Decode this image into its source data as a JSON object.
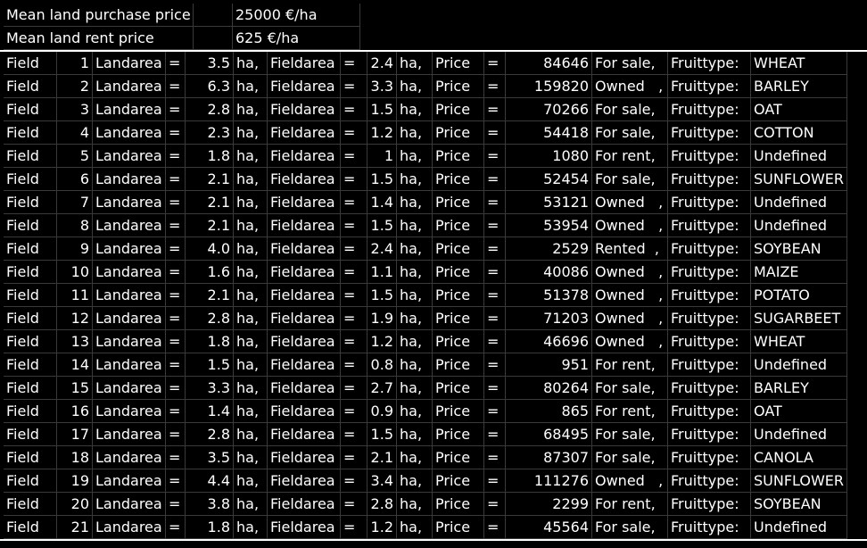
{
  "header": {
    "purchase_label": "Mean land purchase price",
    "purchase_value": "25000 €/ha",
    "rent_label": "Mean land rent price",
    "rent_value": "625 €/ha"
  },
  "labels": {
    "field": "Field",
    "landarea": "Landarea",
    "eq": "=",
    "ha": "ha,",
    "fieldarea": "Fieldarea",
    "price": "Price",
    "euro": "€,",
    "fruittype": "Fruittype:"
  },
  "fields": [
    {
      "num": "1",
      "land": "3.5",
      "area": "2.4",
      "price": "84646",
      "status": "For sale,",
      "fruit": "WHEAT"
    },
    {
      "num": "2",
      "land": "6.3",
      "area": "3.3",
      "price": "159820",
      "status": "Owned   ,",
      "fruit": "BARLEY"
    },
    {
      "num": "3",
      "land": "2.8",
      "area": "1.5",
      "price": "70266",
      "status": "For sale,",
      "fruit": "OAT"
    },
    {
      "num": "4",
      "land": "2.3",
      "area": "1.2",
      "price": "54418",
      "status": "For sale,",
      "fruit": "COTTON"
    },
    {
      "num": "5",
      "land": "1.8",
      "area": "1",
      "price": "1080",
      "status": "For rent,",
      "fruit": "Undefined"
    },
    {
      "num": "6",
      "land": "2.1",
      "area": "1.5",
      "price": "52454",
      "status": "For sale,",
      "fruit": "SUNFLOWER"
    },
    {
      "num": "7",
      "land": "2.1",
      "area": "1.4",
      "price": "53121",
      "status": "Owned   ,",
      "fruit": "Undefined"
    },
    {
      "num": "8",
      "land": "2.1",
      "area": "1.5",
      "price": "53954",
      "status": "Owned   ,",
      "fruit": "Undefined"
    },
    {
      "num": "9",
      "land": "4.0",
      "area": "2.4",
      "price": "2529",
      "status": "Rented  ,",
      "fruit": "SOYBEAN"
    },
    {
      "num": "10",
      "land": "1.6",
      "area": "1.1",
      "price": "40086",
      "status": "Owned   ,",
      "fruit": "MAIZE"
    },
    {
      "num": "11",
      "land": "2.1",
      "area": "1.5",
      "price": "51378",
      "status": "Owned   ,",
      "fruit": "POTATO"
    },
    {
      "num": "12",
      "land": "2.8",
      "area": "1.9",
      "price": "71203",
      "status": "Owned   ,",
      "fruit": "SUGARBEET"
    },
    {
      "num": "13",
      "land": "1.8",
      "area": "1.2",
      "price": "46696",
      "status": "Owned   ,",
      "fruit": "WHEAT"
    },
    {
      "num": "14",
      "land": "1.5",
      "area": "0.8",
      "price": "951",
      "status": "For rent,",
      "fruit": "Undefined"
    },
    {
      "num": "15",
      "land": "3.3",
      "area": "2.7",
      "price": "80264",
      "status": "For sale,",
      "fruit": "BARLEY"
    },
    {
      "num": "16",
      "land": "1.4",
      "area": "0.9",
      "price": "865",
      "status": "For rent,",
      "fruit": "OAT"
    },
    {
      "num": "17",
      "land": "2.8",
      "area": "1.5",
      "price": "68495",
      "status": "For sale,",
      "fruit": "Undefined"
    },
    {
      "num": "18",
      "land": "3.5",
      "area": "2.1",
      "price": "87307",
      "status": "For sale,",
      "fruit": "CANOLA"
    },
    {
      "num": "19",
      "land": "4.4",
      "area": "3.4",
      "price": "111276",
      "status": "Owned   ,",
      "fruit": "SUNFLOWER"
    },
    {
      "num": "20",
      "land": "3.8",
      "area": "2.8",
      "price": "2299",
      "status": "For rent,",
      "fruit": "SOYBEAN"
    },
    {
      "num": "21",
      "land": "1.8",
      "area": "1.2",
      "price": "45564",
      "status": "For sale,",
      "fruit": "Undefined"
    }
  ]
}
